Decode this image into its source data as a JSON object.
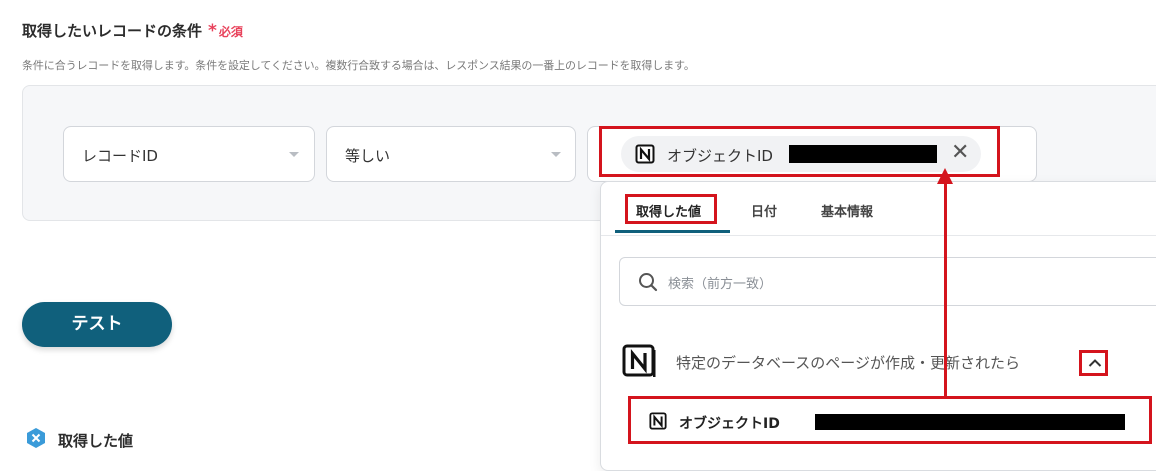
{
  "header": {
    "title": "取得したいレコードの条件",
    "required_star": "*",
    "required_label": "必須",
    "description": "条件に合うレコードを取得します。条件を設定してください。複数行合致する場合は、レスポンス結果の一番上のレコードを取得します。"
  },
  "condition": {
    "field_select": "レコードID",
    "operator_select": "等しい",
    "value_chip": {
      "icon": "notion-icon",
      "label": "オブジェクトID",
      "remove_symbol": "✕"
    }
  },
  "dropdown": {
    "tabs": [
      {
        "label": "取得した値",
        "active": true
      },
      {
        "label": "日付",
        "active": false
      },
      {
        "label": "基本情報",
        "active": false
      }
    ],
    "search": {
      "placeholder": "検索（前方一致）"
    },
    "section": {
      "icon": "notion-icon",
      "title": "特定のデータベースのページが作成・更新されたら",
      "expanded": true
    },
    "items": [
      {
        "label": "オブジェクトID"
      }
    ]
  },
  "test_button": {
    "label": "テスト"
  },
  "result": {
    "label": "取得した値"
  },
  "colors": {
    "accent": "#10607c",
    "required": "#e8425b",
    "annotation": "#d4141d"
  }
}
